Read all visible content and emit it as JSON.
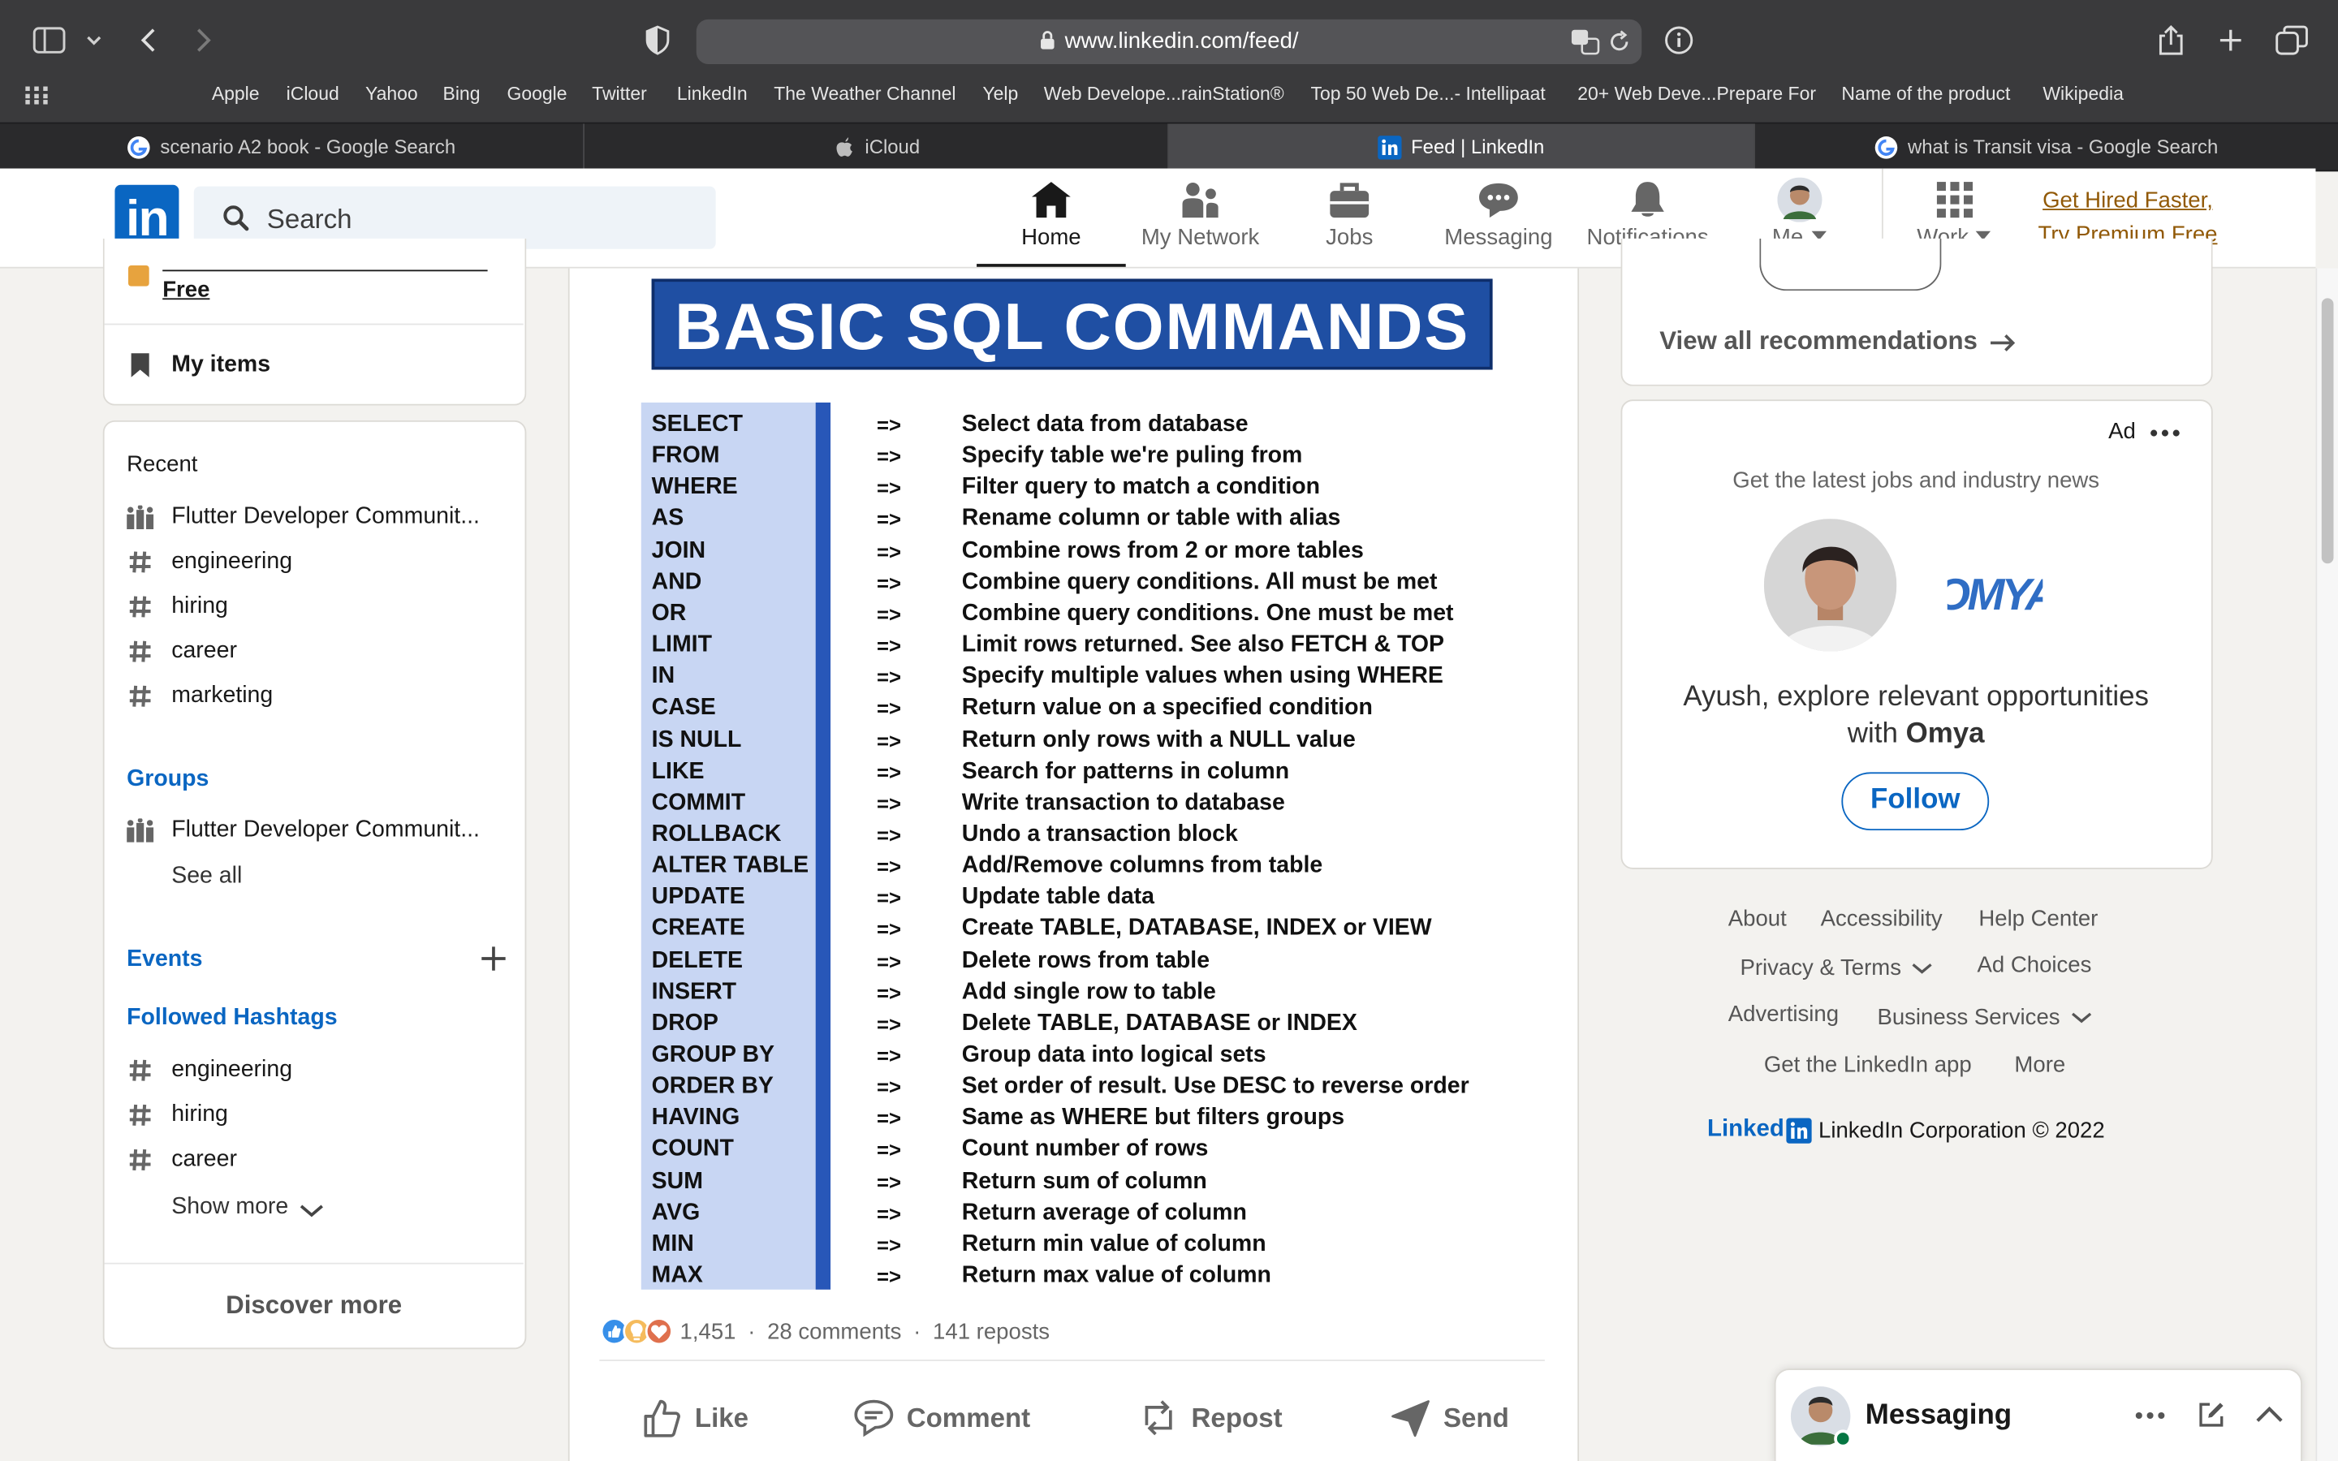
{
  "browser": {
    "url": "www.linkedin.com/feed/",
    "bookmarks": [
      "Apple",
      "iCloud",
      "Yahoo",
      "Bing",
      "Google",
      "Twitter",
      "LinkedIn",
      "The Weather Channel",
      "Yelp",
      "Web Develope...rainStation®",
      "Top 50 Web De...- Intellipaat",
      "20+ Web Deve...Prepare For",
      "Name of the product",
      "Wikipedia"
    ],
    "tabs": [
      {
        "label": "scenario A2 book - Google Search",
        "icon": "google-icon"
      },
      {
        "label": "iCloud",
        "icon": "apple-icon"
      },
      {
        "label": "Feed | LinkedIn",
        "icon": "linkedin-icon",
        "active": true
      },
      {
        "label": "what is Transit visa - Google Search",
        "icon": "google-icon"
      }
    ]
  },
  "nav": {
    "logo": "in",
    "search_placeholder": "Search",
    "items": [
      {
        "label": "Home",
        "icon": "home-icon",
        "active": true
      },
      {
        "label": "My Network",
        "icon": "network-icon"
      },
      {
        "label": "Jobs",
        "icon": "briefcase-icon"
      },
      {
        "label": "Messaging",
        "icon": "messaging-icon"
      },
      {
        "label": "Notifications",
        "icon": "bell-icon"
      },
      {
        "label": "Me",
        "icon": "avatar"
      },
      {
        "label": "Work",
        "icon": "grid-icon"
      }
    ],
    "premium_line1": "Get Hired Faster,",
    "premium_line2": "Try Premium Free",
    "accent": "#0a66c2",
    "premium_color": "#915907"
  },
  "left": {
    "premium_cut": "Free",
    "my_items": "My items",
    "recent_title": "Recent",
    "recent": [
      {
        "label": "Flutter Developer Communit...",
        "icon": "group-icon"
      },
      {
        "label": "engineering",
        "icon": "hashtag-icon"
      },
      {
        "label": "hiring",
        "icon": "hashtag-icon"
      },
      {
        "label": "career",
        "icon": "hashtag-icon"
      },
      {
        "label": "marketing",
        "icon": "hashtag-icon"
      }
    ],
    "groups_title": "Groups",
    "groups": [
      {
        "label": "Flutter Developer Communit...",
        "icon": "group-icon"
      }
    ],
    "see_all": "See all",
    "events_title": "Events",
    "hashtags_title": "Followed Hashtags",
    "hashtags": [
      "engineering",
      "hiring",
      "career"
    ],
    "show_more": "Show more",
    "discover_more": "Discover more"
  },
  "post": {
    "image_title": "BASIC SQL COMMANDS",
    "arrow": "=>",
    "commands": [
      {
        "cmd": "SELECT",
        "desc": "Select data from database"
      },
      {
        "cmd": "FROM",
        "desc": "Specify table we're puling from"
      },
      {
        "cmd": "WHERE",
        "desc": "Filter query to match a condition"
      },
      {
        "cmd": "AS",
        "desc": "Rename column or table with alias"
      },
      {
        "cmd": "JOIN",
        "desc": "Combine rows from 2 or more tables"
      },
      {
        "cmd": "AND",
        "desc": "Combine query conditions. All must be met"
      },
      {
        "cmd": "OR",
        "desc": "Combine query conditions. One must be met"
      },
      {
        "cmd": "LIMIT",
        "desc": "Limit rows returned. See also FETCH & TOP"
      },
      {
        "cmd": "IN",
        "desc": "Specify multiple values when using WHERE"
      },
      {
        "cmd": "CASE",
        "desc": "Return value on a specified condition"
      },
      {
        "cmd": "IS NULL",
        "desc": "Return only rows with a NULL value"
      },
      {
        "cmd": "LIKE",
        "desc": "Search for patterns in column"
      },
      {
        "cmd": "COMMIT",
        "desc": "Write transaction to database"
      },
      {
        "cmd": "ROLLBACK",
        "desc": "Undo a transaction block"
      },
      {
        "cmd": "ALTER TABLE",
        "desc": "Add/Remove columns from table"
      },
      {
        "cmd": "UPDATE",
        "desc": "Update table data"
      },
      {
        "cmd": "CREATE",
        "desc": "Create TABLE, DATABASE, INDEX or VIEW"
      },
      {
        "cmd": "DELETE",
        "desc": "Delete rows from table"
      },
      {
        "cmd": "INSERT",
        "desc": "Add single row to table"
      },
      {
        "cmd": "DROP",
        "desc": "Delete TABLE, DATABASE or INDEX"
      },
      {
        "cmd": "GROUP BY",
        "desc": "Group data into logical sets"
      },
      {
        "cmd": "ORDER BY",
        "desc": "Set order of result. Use DESC to reverse order"
      },
      {
        "cmd": "HAVING",
        "desc": "Same as WHERE but filters groups"
      },
      {
        "cmd": "COUNT",
        "desc": "Count number of rows"
      },
      {
        "cmd": "SUM",
        "desc": "Return sum of column"
      },
      {
        "cmd": "AVG",
        "desc": "Return average of column"
      },
      {
        "cmd": "MIN",
        "desc": "Return min value of column"
      },
      {
        "cmd": "MAX",
        "desc": "Return max value of column"
      }
    ],
    "reactions": "1,451",
    "comments": "28 comments",
    "reposts": "141 reposts",
    "actions": [
      {
        "label": "Like",
        "icon": "like-icon"
      },
      {
        "label": "Comment",
        "icon": "comment-icon"
      },
      {
        "label": "Repost",
        "icon": "repost-icon"
      },
      {
        "label": "Send",
        "icon": "send-icon"
      }
    ]
  },
  "right": {
    "view_all": "View all recommendations",
    "ad_label": "Ad",
    "ad_text": "Get the latest jobs and industry news",
    "ad_line1": "Ayush, explore relevant opportunities",
    "ad_line2_prefix": "with ",
    "ad_company": "Omya",
    "company_logo_text": "OMYA",
    "follow": "Follow",
    "footer": {
      "about": "About",
      "accessibility": "Accessibility",
      "help": "Help Center",
      "privacy": "Privacy & Terms",
      "ad_choices": "Ad Choices",
      "advertising": "Advertising",
      "business": "Business Services",
      "app": "Get the LinkedIn app",
      "more": "More",
      "brand": "Linked",
      "copyright": "LinkedIn Corporation © 2022"
    },
    "messaging": "Messaging"
  }
}
